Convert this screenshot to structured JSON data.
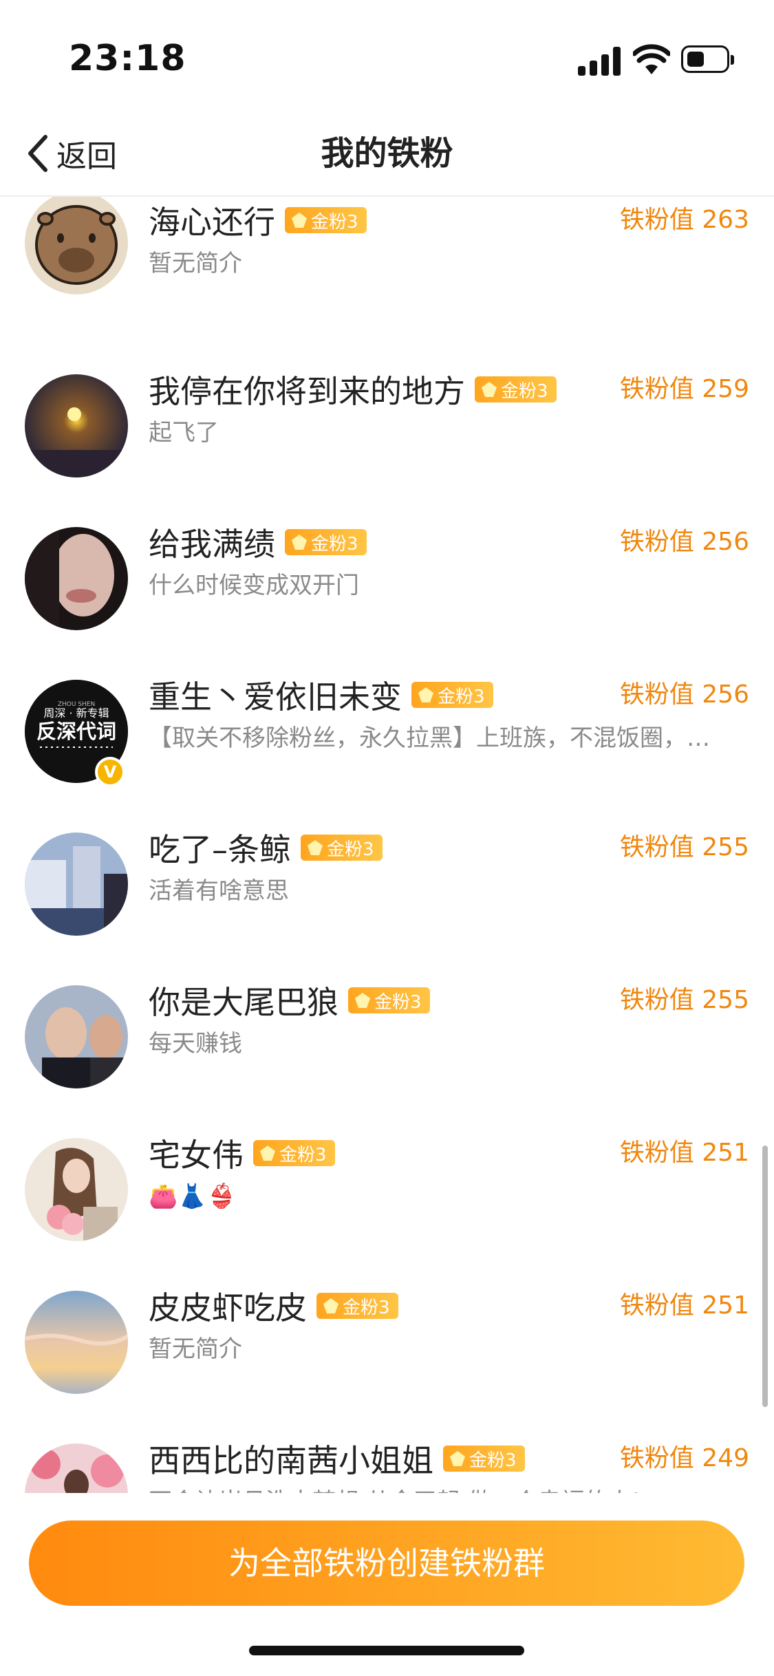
{
  "status_bar": {
    "time": "23:18"
  },
  "nav": {
    "back_label": "返回",
    "title": "我的铁粉"
  },
  "colors": {
    "accent": "#f0870e",
    "badge": "#ffb12f",
    "cta_start": "#ff8a0e",
    "cta_end": "#ffba33"
  },
  "fans": [
    {
      "name": "海心还行",
      "badge": "金粉3",
      "score": "铁粉值 263",
      "bio": "暂无简介"
    },
    {
      "name": "我停在你将到来的地方",
      "badge": "金粉3",
      "score": "铁粉值 259",
      "bio": "起飞了"
    },
    {
      "name": "给我满绩",
      "badge": "金粉3",
      "score": "铁粉值 256",
      "bio": "什么时候变成双开门"
    },
    {
      "name": "重生丶爱依旧未变",
      "badge": "金粉3",
      "score": "铁粉值 256",
      "bio": "【取关不移除粉丝，永久拉黑】上班族，不混饭圈，…",
      "avatar_lines": [
        "ZHOU SHEN",
        "周深 · 新专辑",
        "反深代词"
      ]
    },
    {
      "name": "吃了–条鲸",
      "badge": "金粉3",
      "score": "铁粉值 255",
      "bio": "活着有啥意思"
    },
    {
      "name": "你是大尾巴狼",
      "badge": "金粉3",
      "score": "铁粉值 255",
      "bio": "每天赚钱"
    },
    {
      "name": "宅女伟",
      "badge": "金粉3",
      "score": "铁粉值 251",
      "bio": "👛👗👙"
    },
    {
      "name": "皮皮虾吃皮",
      "badge": "金粉3",
      "score": "铁粉值 251",
      "bio": "暂无简介"
    },
    {
      "name": "西西比的南茜小姐姐",
      "badge": "金粉3",
      "score": "铁粉值 249",
      "bio": "不会让岁月洗去梦想.从今天起.做一个幸福的人!"
    }
  ],
  "verified_mark": "V",
  "cta": {
    "label": "为全部铁粉创建铁粉群"
  }
}
